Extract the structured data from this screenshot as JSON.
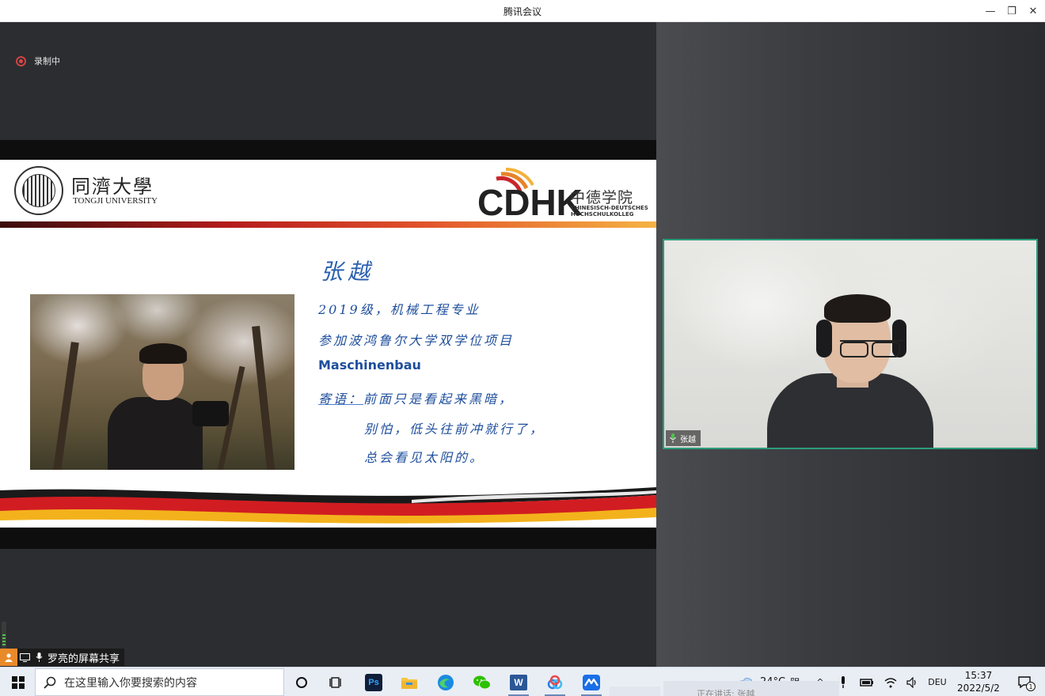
{
  "window": {
    "title": "腾讯会议",
    "minimize_glyph": "—",
    "restore_glyph": "❐",
    "close_glyph": "✕"
  },
  "recording": {
    "label": "录制中",
    "color": "#e04545"
  },
  "slide": {
    "header": {
      "university_cn": "同濟大學",
      "university_en": "TONGJI UNIVERSITY",
      "college_logo": "CDHK",
      "college_cn": "中德学院",
      "college_de_line1": "CHINESISCH-DEUTSCHES",
      "college_de_line2": "HOCHSCHULKOLLEG"
    },
    "name": "张越",
    "lines": {
      "line1": "2019级，机械工程专业",
      "line2": "参加波鸿鲁尔大学双学位项目",
      "line3": "Maschinenbau",
      "line4_label": "寄语：",
      "line4_text": "前面只是看起来黑暗，",
      "line5": "别怕，低头往前冲就行了，",
      "line6": "总会看见太阳的。"
    }
  },
  "video": {
    "participant_name": "张越",
    "border_color": "#2a9d7a"
  },
  "share_tag": {
    "label": "罗亮的屏幕共享"
  },
  "taskbar": {
    "search_placeholder": "在这里输入你要搜索的内容",
    "apps": [
      "cortana-icon",
      "task-view-icon",
      "photoshop-icon",
      "file-explorer-icon",
      "edge-icon",
      "wechat-icon",
      "word-icon",
      "baidu-netdisk-icon",
      "tencent-meeting-icon"
    ],
    "photoshop_label": "Ps",
    "word_label": "W",
    "weather_temp": "24°C",
    "weather_desc": "阴",
    "language": "DEU",
    "time": "15:37",
    "date": "2022/5/2",
    "notification_count": "1",
    "ghost_text": "正在讲话: 张越"
  }
}
